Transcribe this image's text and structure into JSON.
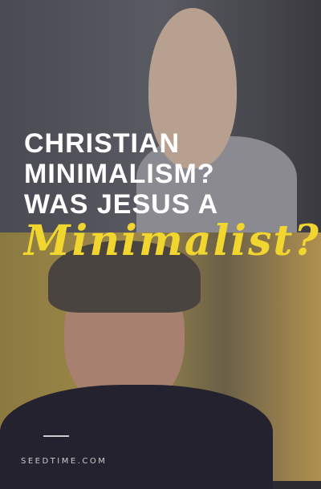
{
  "title_lines": [
    "CHRISTIAN",
    "MINIMALISM?",
    "WAS JESUS A"
  ],
  "script_word": "Minimalist?",
  "site": "SEEDTIME.COM",
  "colors": {
    "accent": "#f2d630",
    "text": "#ffffff"
  }
}
